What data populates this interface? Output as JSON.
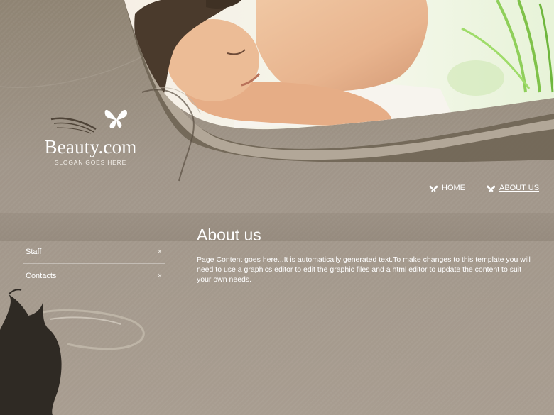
{
  "logo": {
    "title": "Beauty.com",
    "slogan": "SLOGAN GOES HERE",
    "icon": "butterfly-icon"
  },
  "nav": {
    "items": [
      {
        "label": "HOME",
        "icon": "butterfly-icon",
        "active": false
      },
      {
        "label": "ABOUT US",
        "icon": "butterfly-icon",
        "active": true
      }
    ]
  },
  "sidebar": {
    "items": [
      {
        "label": "Staff",
        "icon": "close-icon",
        "glyph": "×"
      },
      {
        "label": "Contacts",
        "icon": "close-icon",
        "glyph": "×"
      }
    ]
  },
  "main": {
    "title": "About us",
    "text": "Page Content goes here...It is automatically generated text.To make changes to this template you will need to use a graphics editor to edit the graphic files and a html editor to update the content to suit your own needs."
  },
  "colors": {
    "background": "#a1968a",
    "header_dark": "#5f5446",
    "silhouette": "#2f2a24"
  }
}
